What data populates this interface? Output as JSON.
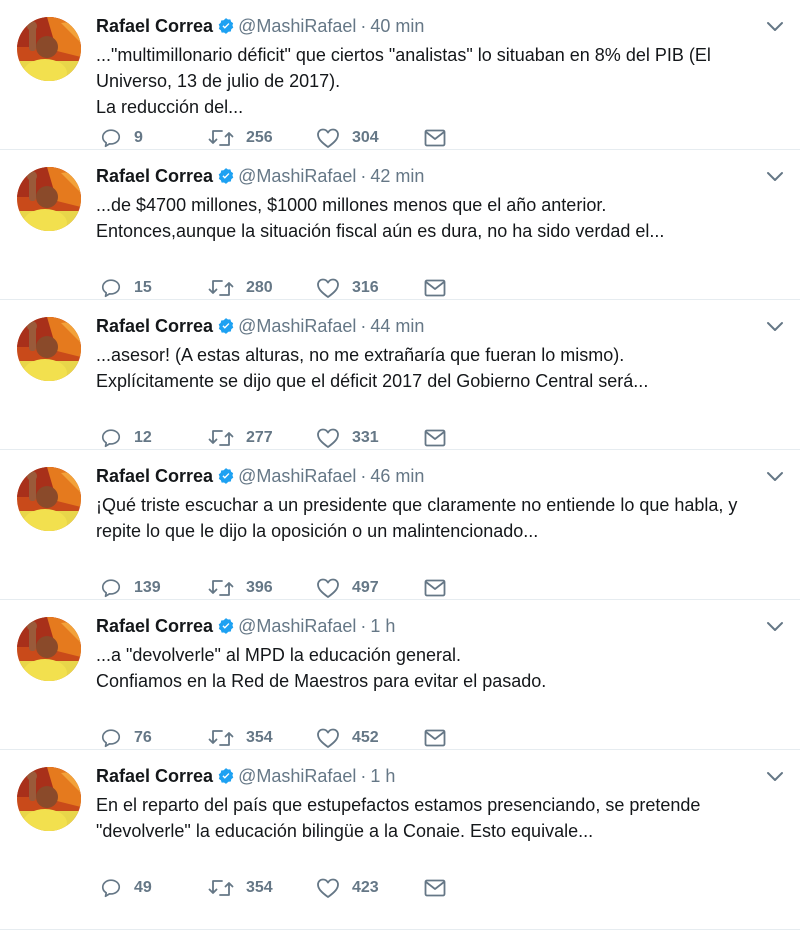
{
  "tweets": [
    {
      "name": "Rafael Correa",
      "handle": "@MashiRafael",
      "time": "40 min",
      "lines": [
        "...\"multimillonario déficit\" que ciertos \"analistas\" lo situaban en 8% del PIB (El",
        "Universo, 13 de julio de 2017).",
        "La reducción del..."
      ],
      "replies": "9",
      "retweets": "256",
      "likes": "304"
    },
    {
      "name": "Rafael Correa",
      "handle": "@MashiRafael",
      "time": "42 min",
      "lines": [
        "...de $4700 millones, $1000 millones menos que el año anterior.",
        "Entonces,aunque la situación fiscal aún es dura, no ha sido verdad el..."
      ],
      "replies": "15",
      "retweets": "280",
      "likes": "316"
    },
    {
      "name": "Rafael Correa",
      "handle": "@MashiRafael",
      "time": "44 min",
      "lines": [
        "...asesor! (A estas alturas, no me extrañaría que fueran lo mismo).",
        "Explícitamente se dijo que el déficit 2017 del Gobierno Central será..."
      ],
      "replies": "12",
      "retweets": "277",
      "likes": "331"
    },
    {
      "name": "Rafael Correa",
      "handle": "@MashiRafael",
      "time": "46 min",
      "lines": [
        "¡Qué triste escuchar a un presidente que claramente no entiende lo que habla, y",
        "repite lo que le dijo la oposición o un malintencionado..."
      ],
      "replies": "139",
      "retweets": "396",
      "likes": "497"
    },
    {
      "name": "Rafael Correa",
      "handle": "@MashiRafael",
      "time": "1 h",
      "lines": [
        "...a \"devolverle\" al MPD la educación general.",
        "Confiamos en la Red de Maestros para evitar el pasado."
      ],
      "replies": "76",
      "retweets": "354",
      "likes": "452"
    },
    {
      "name": "Rafael Correa",
      "handle": "@MashiRafael",
      "time": "1 h",
      "lines": [
        "En el reparto del país que estupefactos estamos presenciando, se pretende",
        "\"devolverle\" la educación bilingüe a la Conaie. Esto equivale..."
      ],
      "replies": "49",
      "retweets": "354",
      "likes": "423"
    }
  ],
  "separator": "·",
  "colors": {
    "verified": "#1da1f2",
    "muted": "#657786",
    "text": "#14171a",
    "divider": "#e6ecf0"
  },
  "icons": {
    "verified": "verified-badge-icon",
    "caret": "chevron-down-icon",
    "reply": "reply-icon",
    "retweet": "retweet-icon",
    "like": "heart-icon",
    "message": "envelope-icon"
  }
}
